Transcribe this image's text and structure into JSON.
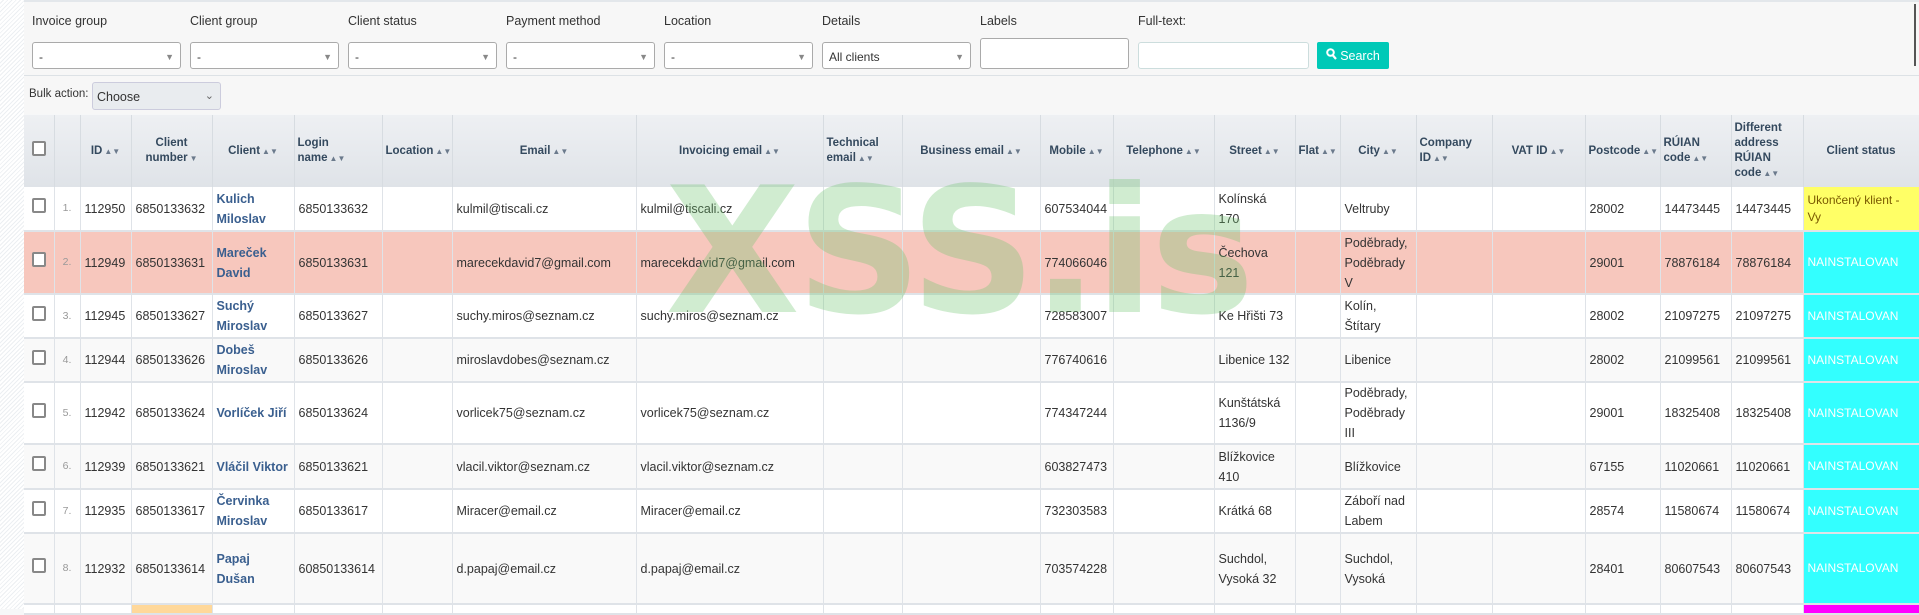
{
  "filters": {
    "items": [
      {
        "label": "Invoice group",
        "value": "-"
      },
      {
        "label": "Client group",
        "value": "-"
      },
      {
        "label": "Client status",
        "value": "-"
      },
      {
        "label": "Payment method",
        "value": "-"
      },
      {
        "label": "Location",
        "value": "-"
      },
      {
        "label": "Details",
        "value": "All clients"
      }
    ],
    "labels_label": "Labels",
    "labels_value": "",
    "fulltext_label": "Full-text:",
    "fulltext_value": "",
    "search_label": "Search",
    "search_icon": "magnifier-icon",
    "accent_color": "#00c9b7"
  },
  "bulk": {
    "label": "Bulk action:",
    "value": "Choose"
  },
  "table": {
    "columns": [
      "",
      "",
      "ID",
      "Client number",
      "Client",
      "Login name",
      "Location",
      "Email",
      "Invoicing email",
      "Technical email",
      "Business email",
      "Mobile",
      "Telephone",
      "Street",
      "Flat",
      "City",
      "Company ID",
      "VAT ID",
      "Postcode",
      "RÚIAN code",
      "Different address RÚIAN code",
      "Client status"
    ],
    "rows": [
      {
        "n": "1.",
        "id": "112950",
        "client_number": "6850133632",
        "client": "Kulich Miloslav",
        "login": "6850133632",
        "location": "",
        "email": "kulmil@tiscali.cz",
        "invoicing_email": "kulmil@tiscali.cz",
        "technical_email": "",
        "business_email": "",
        "mobile": "607534044",
        "telephone": "",
        "street": "Kolínská 170",
        "flat": "",
        "city": "Veltruby",
        "company_id": "",
        "vat_id": "",
        "postcode": "28002",
        "ruian": "14473445",
        "diff_ruian": "14473445",
        "status": "Ukončený klient - Vy",
        "status_color": "#ffff66",
        "status_text_color": "#7a5a00"
      },
      {
        "n": "2.",
        "id": "112949",
        "client_number": "6850133631",
        "client": "Mareček David",
        "login": "6850133631",
        "location": "",
        "email": "marecekdavid7@gmail.com",
        "invoicing_email": "marecekdavid7@gmail.com",
        "technical_email": "",
        "business_email": "",
        "mobile": "774066046",
        "telephone": "",
        "street": "Čechova 121",
        "flat": "",
        "city": "Poděbrady, Poděbrady V",
        "company_id": "",
        "vat_id": "",
        "postcode": "29001",
        "ruian": "78876184",
        "diff_ruian": "78876184",
        "status": "NAINSTALOVAN",
        "status_color": "#33ffff",
        "status_text_color": "#ffffff",
        "highlight": "#f7c7bd"
      },
      {
        "n": "3.",
        "id": "112945",
        "client_number": "6850133627",
        "client": "Suchý Miroslav",
        "login": "6850133627",
        "location": "",
        "email": "suchy.miros@seznam.cz",
        "invoicing_email": "suchy.miros@seznam.cz",
        "technical_email": "",
        "business_email": "",
        "mobile": "728583007",
        "telephone": "",
        "street": "Ke Hřišti 73",
        "flat": "",
        "city": "Kolín, Štítary",
        "company_id": "",
        "vat_id": "",
        "postcode": "28002",
        "ruian": "21097275",
        "diff_ruian": "21097275",
        "status": "NAINSTALOVAN",
        "status_color": "#33ffff",
        "status_text_color": "#ffffff"
      },
      {
        "n": "4.",
        "id": "112944",
        "client_number": "6850133626",
        "client": "Dobeš Miroslav",
        "login": "6850133626",
        "location": "",
        "email": "miroslavdobes@seznam.cz",
        "invoicing_email": "",
        "technical_email": "",
        "business_email": "",
        "mobile": "776740616",
        "telephone": "",
        "street": "Libenice 132",
        "flat": "",
        "city": "Libenice",
        "company_id": "",
        "vat_id": "",
        "postcode": "28002",
        "ruian": "21099561",
        "diff_ruian": "21099561",
        "status": "NAINSTALOVAN",
        "status_color": "#33ffff",
        "status_text_color": "#ffffff"
      },
      {
        "n": "5.",
        "id": "112942",
        "client_number": "6850133624",
        "client": "Vorlíček Jiří",
        "login": "6850133624",
        "location": "",
        "email": "vorlicek75@seznam.cz",
        "invoicing_email": "vorlicek75@seznam.cz",
        "technical_email": "",
        "business_email": "",
        "mobile": "774347244",
        "telephone": "",
        "street": "Kunštátská 1136/9",
        "flat": "",
        "city": "Poděbrady, Poděbrady III",
        "company_id": "",
        "vat_id": "",
        "postcode": "29001",
        "ruian": "18325408",
        "diff_ruian": "18325408",
        "status": "NAINSTALOVAN",
        "status_color": "#33ffff",
        "status_text_color": "#ffffff"
      },
      {
        "n": "6.",
        "id": "112939",
        "client_number": "6850133621",
        "client": "Vláčil Viktor",
        "login": "6850133621",
        "location": "",
        "email": "vlacil.viktor@seznam.cz",
        "invoicing_email": "vlacil.viktor@seznam.cz",
        "technical_email": "",
        "business_email": "",
        "mobile": "603827473",
        "telephone": "",
        "street": "Blížkovice 410",
        "flat": "",
        "city": "Blížkovice",
        "company_id": "",
        "vat_id": "",
        "postcode": "67155",
        "ruian": "11020661",
        "diff_ruian": "11020661",
        "status": "NAINSTALOVAN",
        "status_color": "#33ffff",
        "status_text_color": "#ffffff"
      },
      {
        "n": "7.",
        "id": "112935",
        "client_number": "6850133617",
        "client": "Červinka Miroslav",
        "login": "6850133617",
        "location": "",
        "email": "Miracer@email.cz",
        "invoicing_email": "Miracer@email.cz",
        "technical_email": "",
        "business_email": "",
        "mobile": "732303583",
        "telephone": "",
        "street": "Krátká 68",
        "flat": "",
        "city": "Záboří nad Labem",
        "company_id": "",
        "vat_id": "",
        "postcode": "28574",
        "ruian": "11580674",
        "diff_ruian": "11580674",
        "status": "NAINSTALOVAN",
        "status_color": "#33ffff",
        "status_text_color": "#ffffff"
      },
      {
        "n": "8.",
        "id": "112932",
        "client_number": "6850133614",
        "client": "Papaj Dušan",
        "login": "60850133614",
        "location": "",
        "email": "d.papaj@email.cz",
        "invoicing_email": "d.papaj@email.cz",
        "technical_email": "",
        "business_email": "",
        "mobile": "703574228",
        "telephone": "",
        "street": "Suchdol, Vysoká 32",
        "flat": "",
        "city": "Suchdol, Vysoká",
        "company_id": "",
        "vat_id": "",
        "postcode": "28401",
        "ruian": "80607543",
        "diff_ruian": "80607543",
        "status": "NAINSTALOVAN",
        "status_color": "#33ffff",
        "status_text_color": "#ffffff"
      }
    ],
    "partial_row": {
      "client_number_color": "#ffd89a",
      "status_color": "#ff00ff"
    }
  },
  "watermark": "XSS.is"
}
